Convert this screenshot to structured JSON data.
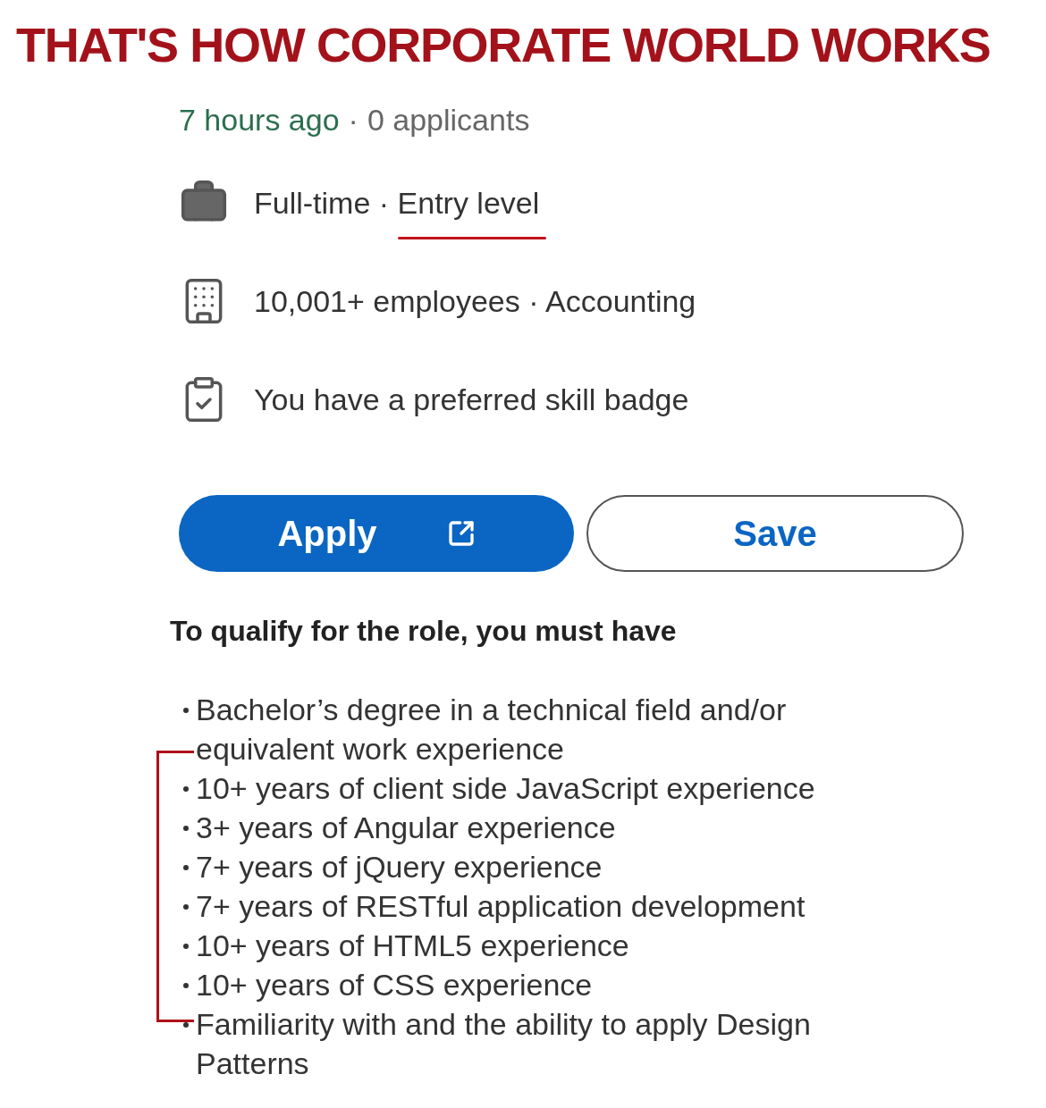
{
  "caption": "THAT'S HOW CORPORATE WORLD WORKS",
  "meta": {
    "posted": "7 hours ago",
    "separator": "·",
    "applicants": "0 applicants"
  },
  "insights": [
    {
      "kind": "briefcase",
      "text": "Full-time · ",
      "highlight": "Entry level"
    },
    {
      "kind": "building",
      "text": "10,001+ employees · Accounting"
    },
    {
      "kind": "clipboard",
      "text": "You have a preferred skill badge"
    }
  ],
  "buttons": [
    {
      "kind": "primary",
      "label": "Apply"
    },
    {
      "kind": "outline",
      "label": "Save"
    }
  ],
  "qualifications": {
    "heading": "To qualify for the role, you must have",
    "items": [
      {
        "text": "Bachelor’s degree in a technical field and/or equivalent work experience",
        "bracketed": false
      },
      {
        "text": "10+ years of client side JavaScript experience",
        "bracketed": true
      },
      {
        "text": "3+ years of Angular experience",
        "bracketed": true
      },
      {
        "text": "7+ years of jQuery experience",
        "bracketed": true
      },
      {
        "text": "7+ years of RESTful application development",
        "bracketed": true
      },
      {
        "text": "10+ years of HTML5 experience",
        "bracketed": true
      },
      {
        "text": "10+ years of CSS experience",
        "bracketed": true
      },
      {
        "text": "Familiarity with and the ability to apply Design Patterns",
        "bracketed": false
      }
    ]
  }
}
